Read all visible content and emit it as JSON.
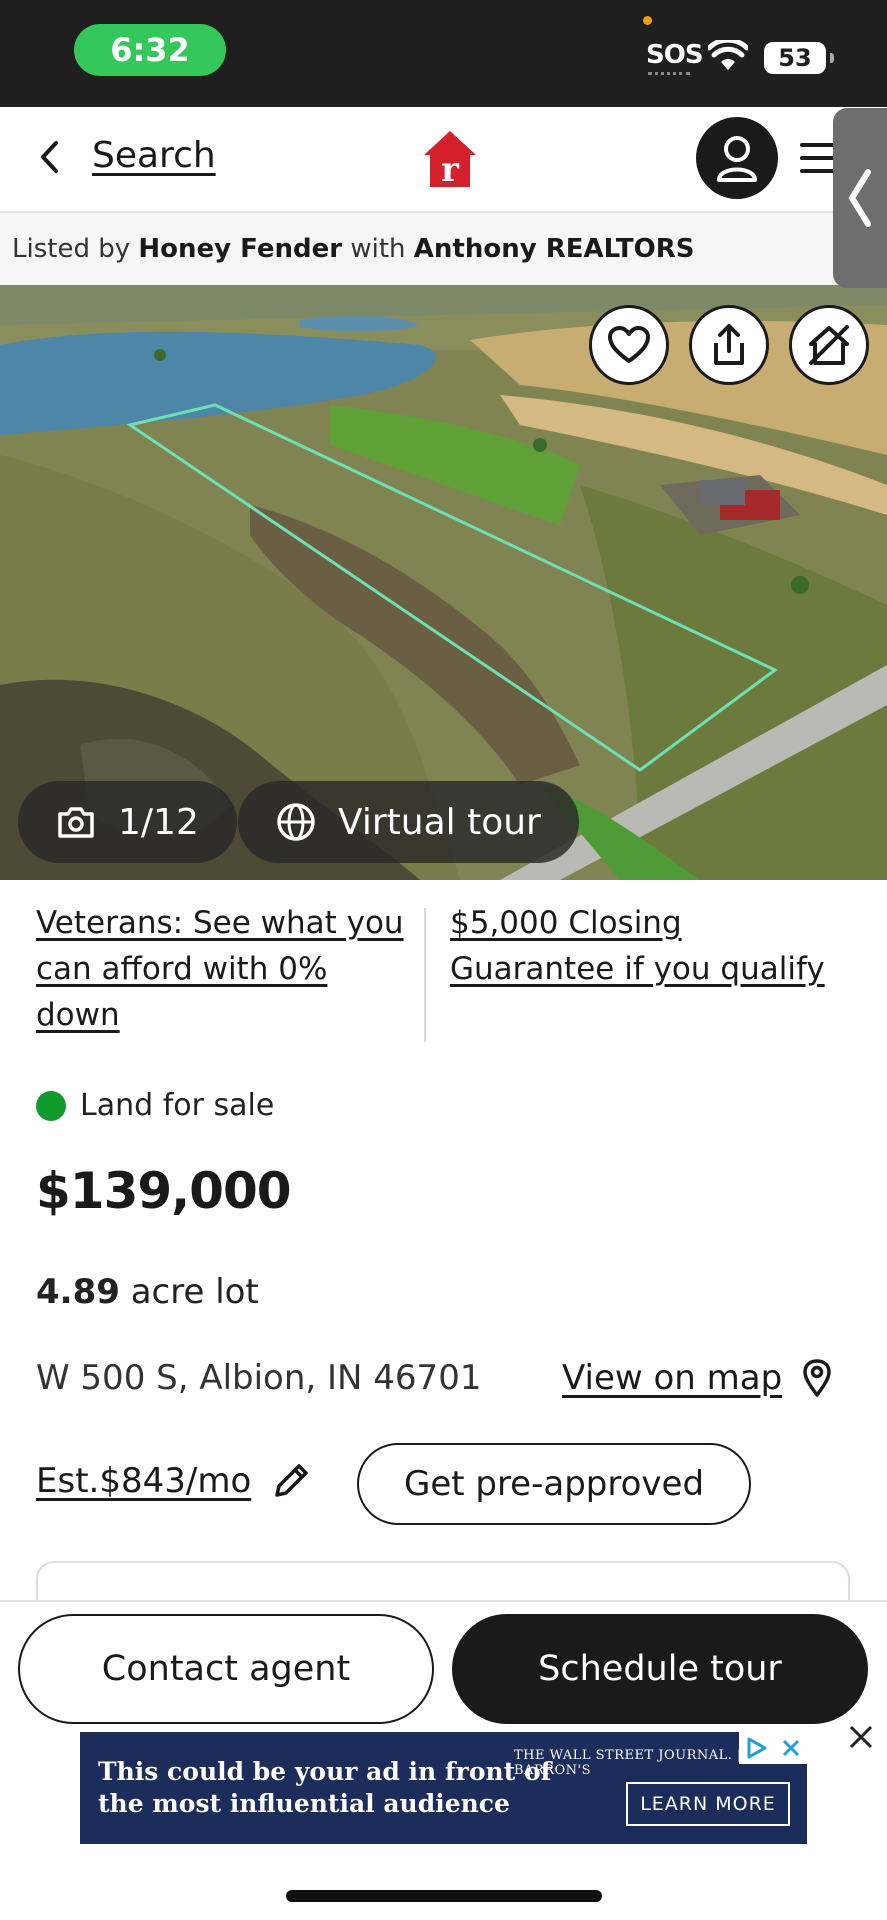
{
  "status_bar": {
    "time": "6:32",
    "carrier": "SOS",
    "battery": "53"
  },
  "nav": {
    "back_label": "Search",
    "brand_letter": "r"
  },
  "listing_attribution": {
    "prefix": "Listed by",
    "agent": "Honey Fender",
    "joiner": "with",
    "brokerage": "Anthony REALTORS"
  },
  "photo": {
    "counter": "1/12",
    "virtual_tour": "Virtual tour"
  },
  "promos": {
    "left": [
      "Veterans: See what you",
      "can afford with 0%",
      "down"
    ],
    "right": [
      "$5,000 Closing",
      "Guarantee if you qualify"
    ]
  },
  "listing": {
    "status": "Land for sale",
    "status_color": "#109c2c",
    "price": "$139,000",
    "lot_value": "4.89",
    "lot_unit": "acre lot",
    "address": "W 500 S, Albion, IN 46701",
    "map_link": "View on map",
    "estimate": "Est.$843/mo",
    "preapproval": "Get pre-approved"
  },
  "actions": {
    "contact": "Contact agent",
    "schedule": "Schedule tour"
  },
  "ad": {
    "line1": "This could be your ad in front of",
    "line2": "the most influential audience",
    "brand": "THE WALL STREET JOURNAL. | BARRON'S",
    "cta": "LEARN MORE"
  }
}
